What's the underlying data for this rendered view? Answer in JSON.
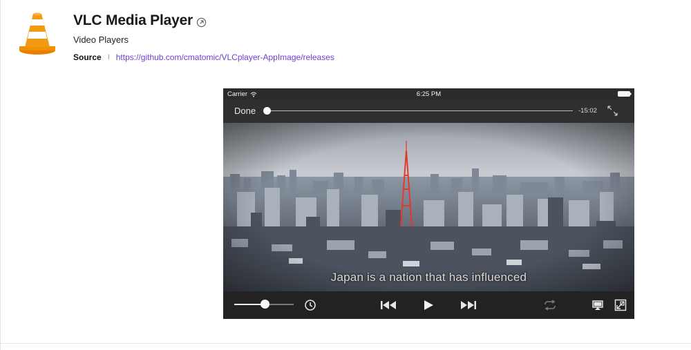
{
  "app": {
    "title": "VLC Media Player",
    "category": "Video Players",
    "source_label": "Source",
    "source_separator": "I",
    "source_url": "https://github.com/cmatomic/VLCplayer-AppImage/releases",
    "logo": "vlc-traffic-cone-logo",
    "accent_color": "#f08a00",
    "link_color": "#6a3fd1"
  },
  "screenshot": {
    "status_bar": {
      "carrier": "Carrier",
      "time": "6:25 PM",
      "icons": [
        "wifi-icon",
        "battery-icon"
      ]
    },
    "top_controls": {
      "done_label": "Done",
      "time_remaining": "-15:02",
      "seek_progress": 0.0,
      "icons": [
        "fullscreen-toggle-icon"
      ]
    },
    "video": {
      "subtitle": "Japan is a nation that has influenced"
    },
    "bottom_controls": {
      "volume_level": 0.52,
      "icons": [
        "sleep-timer-icon",
        "previous-icon",
        "play-icon",
        "next-icon",
        "repeat-icon",
        "airplay-icon",
        "aspect-ratio-icon"
      ]
    }
  }
}
